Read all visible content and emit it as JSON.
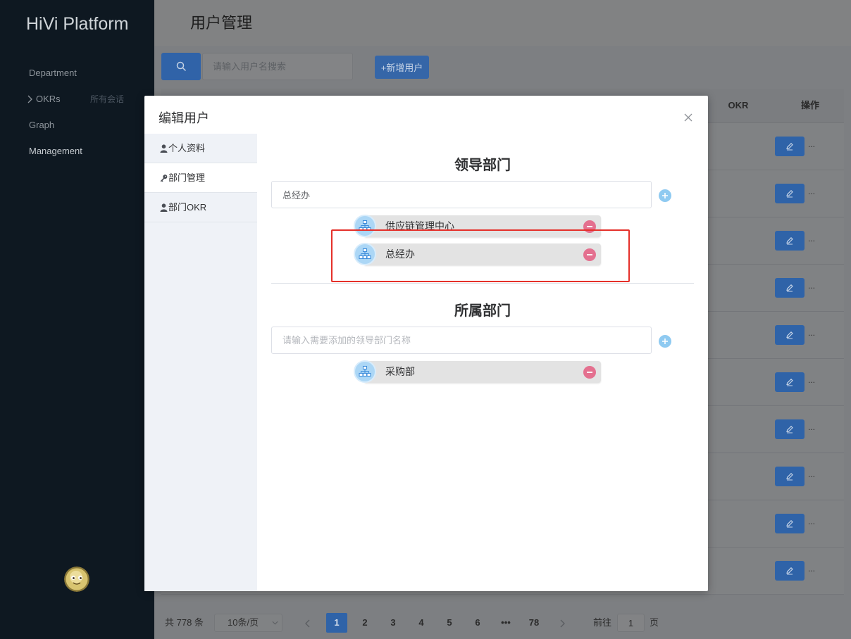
{
  "app": {
    "title": "HiVi Platform"
  },
  "sidebar": {
    "items": [
      {
        "label": "Department",
        "active": false
      },
      {
        "label": "OKRs",
        "icon": "chevron-right-icon",
        "sub_label": "所有会话",
        "active": false
      },
      {
        "label": "Graph",
        "active": false
      },
      {
        "label": "Management",
        "active": true
      }
    ],
    "avatar_icon": "avatar-face"
  },
  "header": {
    "title": "用户管理"
  },
  "toolbar": {
    "search_icon": "search-icon",
    "search_placeholder": "请输入用户名搜索",
    "add_user_label": "+新增用户"
  },
  "table": {
    "columns": [
      "OKR",
      "操作"
    ],
    "rows": [
      {
        "action_icon": "edit-icon",
        "more": "..."
      },
      {
        "action_icon": "edit-icon",
        "more": "..."
      },
      {
        "action_icon": "edit-icon",
        "more": "..."
      },
      {
        "action_icon": "edit-icon",
        "more": "..."
      },
      {
        "action_icon": "edit-icon",
        "more": "..."
      },
      {
        "action_icon": "edit-icon",
        "more": "..."
      },
      {
        "action_icon": "edit-icon",
        "more": "..."
      },
      {
        "action_icon": "edit-icon",
        "more": "..."
      },
      {
        "action_icon": "edit-icon",
        "more": "..."
      },
      {
        "action_icon": "edit-icon",
        "more": "..."
      }
    ]
  },
  "pagination": {
    "total_text": "共 778 条",
    "page_size": "10条/页",
    "pages": [
      "1",
      "2",
      "3",
      "4",
      "5",
      "6",
      "•••",
      "78"
    ],
    "current_page": "1",
    "goto_label": "前往",
    "goto_value": "1",
    "goto_suffix": "页"
  },
  "modal": {
    "title": "编辑用户",
    "tabs": [
      {
        "label": "个人资料",
        "icon": "user-icon",
        "active": false
      },
      {
        "label": "部门管理",
        "icon": "key-icon",
        "active": true
      },
      {
        "label": "部门OKR",
        "icon": "user-icon",
        "active": false
      }
    ],
    "lead_section": {
      "title": "领导部门",
      "input_value": "总经办",
      "items": [
        "供应链管理中心",
        "总经办"
      ]
    },
    "member_section": {
      "title": "所属部门",
      "input_placeholder": "请输入需要添加的领导部门名称",
      "items": [
        "采购部"
      ]
    }
  },
  "colors": {
    "primary": "#3063a8",
    "sidebar_bg": "#0e1821",
    "add_icon": "#8fcaf1",
    "remove_icon": "#e4708f",
    "org_badge": "#acd7f6",
    "annotation_box": "#e5302a"
  }
}
